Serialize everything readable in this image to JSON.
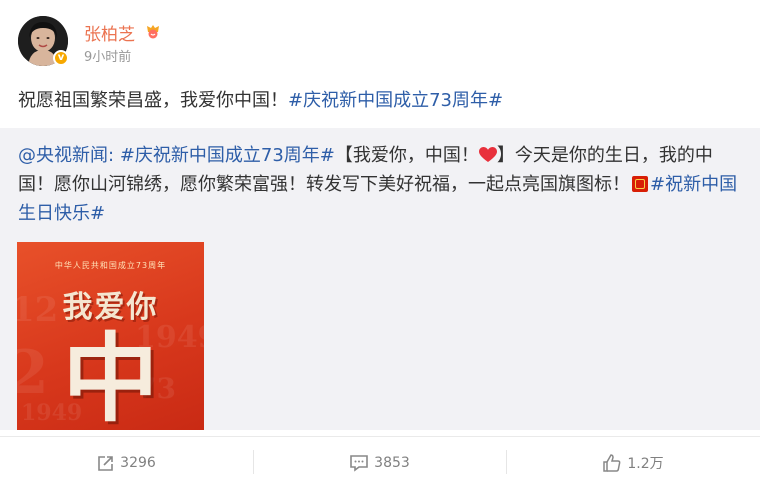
{
  "user": {
    "name": "张柏芝",
    "time": "9小时前",
    "verified_color": "#f7a800",
    "name_color": "#eb7350"
  },
  "post": {
    "text_main": "祝愿祖国繁荣昌盛，我爱你中国！",
    "hashtag": "#庆祝新中国成立73周年#"
  },
  "repost": {
    "author": "@央视新闻:",
    "hashtag1": "#庆祝新中国成立73周年#",
    "part1": "【我爱你，中国！",
    "part2": "】今天是你的生日，我的中国！愿你山河锦绣，愿你繁荣富强！转发写下美好祝福，一起点亮国旗图标！",
    "hashtag2": "#祝新中国生日快乐#",
    "image": {
      "subtitle": "中华人民共和国成立73周年",
      "title": "我爱你",
      "big_char": "中"
    }
  },
  "actions": {
    "forward_count": "3296",
    "comment_count": "3853",
    "like_count": "1.2万",
    "icons": [
      "share-icon",
      "comment-icon",
      "thumbs-up-icon"
    ]
  },
  "colors": {
    "link": "#2e5ea8",
    "repost_bg": "#f2f2f5"
  }
}
